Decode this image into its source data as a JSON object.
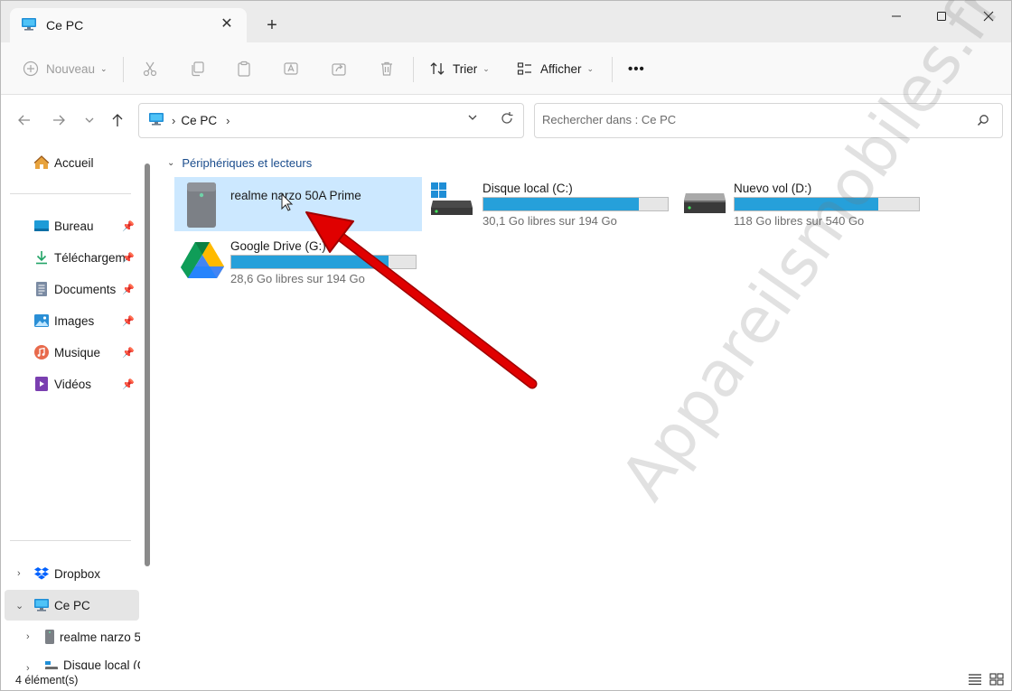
{
  "tab": {
    "title": "Ce PC",
    "close_icon": "close-icon",
    "new_tab_label": "+"
  },
  "window_controls": [
    "minimize-icon",
    "maximize-icon",
    "close-icon"
  ],
  "command_bar": {
    "new_label": "Nouveau",
    "sort_label": "Trier",
    "view_label": "Afficher",
    "more_label": "•••"
  },
  "address": {
    "crumbs": [
      "Ce PC"
    ]
  },
  "search": {
    "placeholder": "Rechercher dans : Ce PC"
  },
  "sidebar": {
    "home": "Accueil",
    "pinned": [
      {
        "label": "Bureau",
        "icon": "desktop-folder-icon"
      },
      {
        "label": "Téléchargem",
        "icon": "downloads-icon"
      },
      {
        "label": "Documents",
        "icon": "documents-icon"
      },
      {
        "label": "Images",
        "icon": "pictures-icon"
      },
      {
        "label": "Musique",
        "icon": "music-icon"
      },
      {
        "label": "Vidéos",
        "icon": "videos-icon"
      }
    ],
    "tree": [
      {
        "label": "Dropbox",
        "icon": "dropbox-icon"
      },
      {
        "label": "Ce PC",
        "icon": "pc-icon"
      },
      {
        "label": "realme narzo 5",
        "icon": "phone-device-icon"
      },
      {
        "label": "Disque local (C",
        "icon": "drive-icon"
      }
    ]
  },
  "content": {
    "group_title": "Périphériques et lecteurs",
    "devices": [
      {
        "name": "realme narzo 50A Prime"
      },
      {
        "name": "Disque local (C:)",
        "free": "30,1 Go libres sur 194 Go",
        "used_fraction": 0.845
      },
      {
        "name": "Nuevo vol (D:)",
        "free": "118 Go libres sur 540 Go",
        "used_fraction": 0.78
      },
      {
        "name": "Google Drive (G:)",
        "free": "28,6 Go libres sur 194 Go",
        "used_fraction": 0.853
      }
    ]
  },
  "status": {
    "count": "4 élément(s)"
  },
  "watermark": "Appareilsmobiles.fr",
  "colors": {
    "accent": "#26a0da",
    "arrow": "#e00000",
    "selection": "#cce8ff"
  }
}
